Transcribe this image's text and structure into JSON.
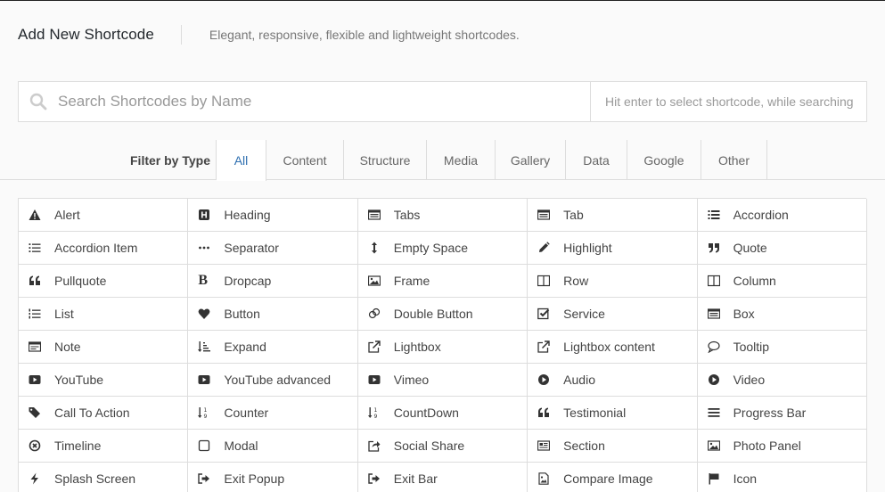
{
  "header": {
    "title": "Add New Shortcode",
    "subtitle": "Elegant, responsive, flexible and lightweight shortcodes."
  },
  "search": {
    "placeholder": "Search Shortcodes by Name",
    "hint": "Hit enter to select shortcode, while searching"
  },
  "filter": {
    "label": "Filter by Type",
    "active": "All",
    "tabs": [
      "All",
      "Content",
      "Structure",
      "Media",
      "Gallery",
      "Data",
      "Google",
      "Other"
    ]
  },
  "accent_color": "#2e6fb0",
  "shortcodes": [
    {
      "label": "Alert",
      "icon": "warning"
    },
    {
      "label": "Heading",
      "icon": "heading"
    },
    {
      "label": "Tabs",
      "icon": "tabs"
    },
    {
      "label": "Tab",
      "icon": "tabs"
    },
    {
      "label": "Accordion",
      "icon": "list-bars"
    },
    {
      "label": "Accordion Item",
      "icon": "list-ul"
    },
    {
      "label": "Separator",
      "icon": "ellipsis"
    },
    {
      "label": "Empty Space",
      "icon": "arrows-v"
    },
    {
      "label": "Highlight",
      "icon": "pencil"
    },
    {
      "label": "Quote",
      "icon": "quote-right"
    },
    {
      "label": "Pullquote",
      "icon": "quote-left"
    },
    {
      "label": "Dropcap",
      "icon": "bold"
    },
    {
      "label": "Frame",
      "icon": "picture"
    },
    {
      "label": "Row",
      "icon": "columns"
    },
    {
      "label": "Column",
      "icon": "columns"
    },
    {
      "label": "List",
      "icon": "list-ol"
    },
    {
      "label": "Button",
      "icon": "heart"
    },
    {
      "label": "Double Button",
      "icon": "link-rings"
    },
    {
      "label": "Service",
      "icon": "check-square"
    },
    {
      "label": "Box",
      "icon": "tabs"
    },
    {
      "label": "Note",
      "icon": "note"
    },
    {
      "label": "Expand",
      "icon": "sort-amount"
    },
    {
      "label": "Lightbox",
      "icon": "external-link"
    },
    {
      "label": "Lightbox content",
      "icon": "external-link"
    },
    {
      "label": "Tooltip",
      "icon": "comment"
    },
    {
      "label": "YouTube",
      "icon": "youtube"
    },
    {
      "label": "YouTube advanced",
      "icon": "youtube"
    },
    {
      "label": "Vimeo",
      "icon": "youtube"
    },
    {
      "label": "Audio",
      "icon": "play-circle"
    },
    {
      "label": "Video",
      "icon": "play-circle"
    },
    {
      "label": "Call To Action",
      "icon": "tags"
    },
    {
      "label": "Counter",
      "icon": "sort-numeric"
    },
    {
      "label": "CountDown",
      "icon": "sort-numeric"
    },
    {
      "label": "Testimonial",
      "icon": "quote-left"
    },
    {
      "label": "Progress Bar",
      "icon": "bars"
    },
    {
      "label": "Timeline",
      "icon": "times-circle"
    },
    {
      "label": "Modal",
      "icon": "square"
    },
    {
      "label": "Social Share",
      "icon": "share"
    },
    {
      "label": "Section",
      "icon": "section"
    },
    {
      "label": "Photo Panel",
      "icon": "picture"
    },
    {
      "label": "Splash Screen",
      "icon": "bolt"
    },
    {
      "label": "Exit Popup",
      "icon": "sign-out"
    },
    {
      "label": "Exit Bar",
      "icon": "sign-out"
    },
    {
      "label": "Compare Image",
      "icon": "file-image"
    },
    {
      "label": "Icon",
      "icon": "flag"
    }
  ]
}
